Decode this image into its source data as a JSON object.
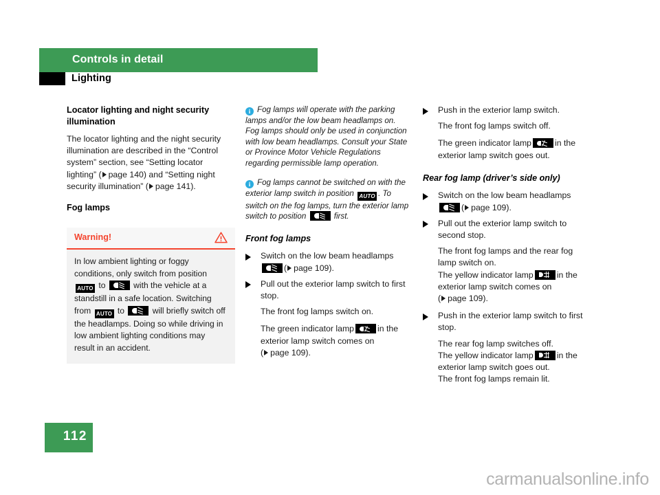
{
  "header": {
    "chapter_title": "Controls in detail",
    "section_title": "Lighting"
  },
  "column_1": {
    "heading_locator": "Locator lighting and night security illumination",
    "paragraph_locator_a": "The locator lighting and the night security illumination are described in the “Control system” section, see “Setting locator lighting” (",
    "paragraph_locator_page_a": "page 140",
    "paragraph_locator_b": ") and “Setting night security illumination” (",
    "paragraph_locator_page_b": "page 141",
    "paragraph_locator_c": ").",
    "heading_fog_lamps": "Fog lamps",
    "warning": {
      "title": "Warning!",
      "icon": "warning-triangle-icon",
      "text_a": "In low ambient lighting or foggy conditions, only switch from position ",
      "symbol_auto": "AUTO",
      "text_b": " to ",
      "symbol_lowbeam": "low-beam-headlamp-symbol",
      "text_c": " with the vehicle at a standstill in a safe location. Switching from ",
      "text_d": " to ",
      "text_e": " will briefly switch off the headlamps. Doing so while driving in low ambient lighting conditions may result in an accident.",
      "accent_color": "#f4442e"
    }
  },
  "column_2": {
    "note_1": "Fog lamps will operate with the parking lamps and/or the low beam headlamps on. Fog lamps should only be used in conjunction with low beam headlamps. Consult your State or Province Motor Vehicle Regulations regarding permissible lamp operation.",
    "note_2_a": "Fog lamps cannot be switched on with the exterior lamp switch in position ",
    "note_2_symbol_auto": "AUTO",
    "note_2_b": ". To switch on the fog lamps, turn the exterior lamp switch to position ",
    "note_2_symbol_lowbeam": "low-beam-headlamp-symbol",
    "note_2_c": " first.",
    "heading_front_fog": "Front fog lamps",
    "step_1": "Switch on the low beam headlamps",
    "step_1_page": "page 109",
    "step_2": "Pull out the exterior lamp switch to first stop.",
    "step_2_result_1": "The front fog lamps switch on.",
    "step_2_result_2_a": "The green indicator lamp",
    "step_2_result_2_b": "in the exterior lamp switch comes on",
    "step_2_result_2_page": "page 109",
    "step_2_result_2_c": ")."
  },
  "column_3": {
    "step_1": "Push in the exterior lamp switch.",
    "step_1_result_1": "The front fog lamps switch off.",
    "step_1_result_2_a": "The green indicator lamp",
    "step_1_result_2_b": "in the exterior lamp switch goes out.",
    "heading_rear_fog": "Rear fog lamp (driver’s side only)",
    "step_2": "Switch on the low beam headlamps",
    "step_2_page": "page 109",
    "step_3": "Pull out the exterior lamp switch to second stop.",
    "step_3_result_1": "The front fog lamps and the rear fog lamp switch on.",
    "step_3_result_2_a": "The yellow indicator lamp",
    "step_3_result_2_b": "in the exterior lamp switch comes on",
    "step_3_result_2_page": "page 109",
    "step_3_result_2_c": ").",
    "step_4": "Push in the exterior lamp switch to first stop.",
    "step_4_result_1": "The rear fog lamp switches off.",
    "step_4_result_2_a": "The yellow indicator lamp",
    "step_4_result_2_b": "in the exterior lamp switch goes out.",
    "step_4_result_3": "The front fog lamps remain lit."
  },
  "footer": {
    "page_number": "112",
    "watermark": "carmanualsonline.info"
  },
  "colors": {
    "brand_green": "#3d9b55",
    "warning_red": "#f4442e",
    "info_blue": "#2cacdf",
    "symbol_black": "#000000"
  }
}
